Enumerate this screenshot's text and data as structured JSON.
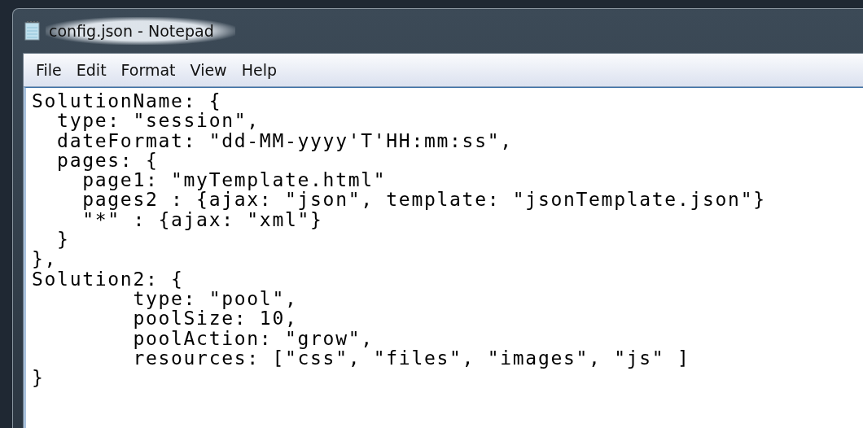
{
  "window": {
    "title": "config.json - Notepad"
  },
  "menu": [
    {
      "label": "File"
    },
    {
      "label": "Edit"
    },
    {
      "label": "Format"
    },
    {
      "label": "View"
    },
    {
      "label": "Help"
    }
  ],
  "editor": {
    "lines": [
      "SolutionName: {",
      "  type: \"session\",",
      "  dateFormat: \"dd-MM-yyyy'T'HH:mm:ss\",",
      "  pages: {",
      "    page1: \"myTemplate.html\"",
      "    pages2 : {ajax: \"json\", template: \"jsonTemplate.json\"}",
      "    \"*\" : {ajax: \"xml\"}",
      "  }",
      "},",
      "Solution2: {",
      "        type: \"pool\",",
      "        poolSize: 10,",
      "        poolAction: \"grow\",",
      "        resources: [\"css\", \"files\", \"images\", \"js\" ]",
      "}"
    ]
  }
}
